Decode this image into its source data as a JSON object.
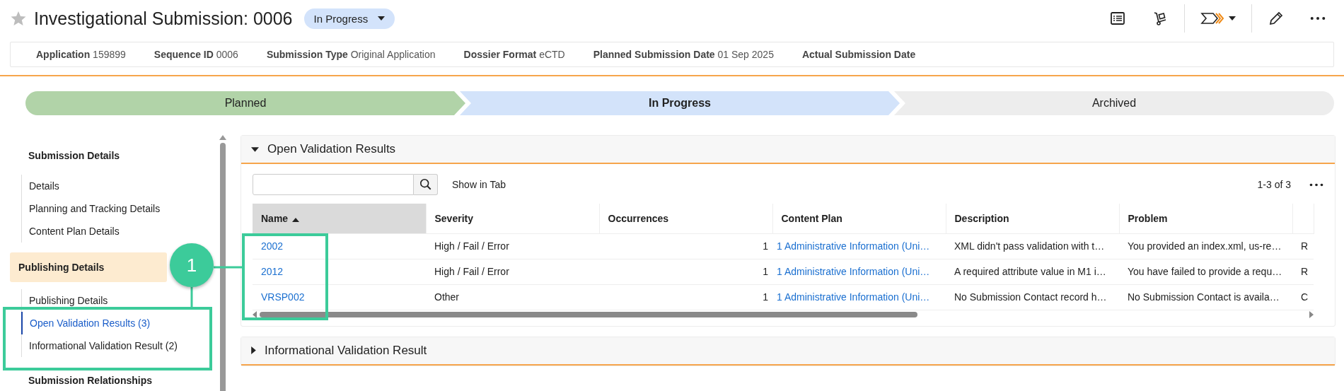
{
  "header": {
    "title": "Investigational Submission: 0006",
    "favorite": false,
    "status": "In Progress"
  },
  "meta": [
    {
      "label": "Application",
      "value": "159899"
    },
    {
      "label": "Sequence ID",
      "value": "0006"
    },
    {
      "label": "Submission Type",
      "value": "Original Application"
    },
    {
      "label": "Dossier Format",
      "value": "eCTD"
    },
    {
      "label": "Planned Submission Date",
      "value": "01 Sep 2025"
    },
    {
      "label": "Actual Submission Date"
    }
  ],
  "stages": [
    {
      "label": "Planned",
      "completed": true,
      "selected": false
    },
    {
      "label": "In Progress",
      "completed": false,
      "selected": true
    },
    {
      "label": "Archived",
      "completed": false,
      "selected": false
    }
  ],
  "sidebar": {
    "sections": [
      {
        "title": "Submission Details",
        "selected": false,
        "items": [
          {
            "label": "Details",
            "selected": false
          },
          {
            "label": "Planning and Tracking Details",
            "selected": false
          },
          {
            "label": "Content Plan Details",
            "selected": false
          }
        ]
      },
      {
        "title": "Publishing Details",
        "selected": true,
        "items": [
          {
            "label": "Publishing Details",
            "selected": false
          },
          {
            "label": "Open Validation Results (3)",
            "selected": true
          },
          {
            "label": "Informational Validation Result (2)",
            "selected": false
          }
        ]
      },
      {
        "title": "Submission Relationships",
        "selected": false
      }
    ]
  },
  "panels": [
    {
      "title": "Open Validation Results",
      "expanded": true,
      "show_in_tab": "Show in Tab",
      "count": "1-3 of 3",
      "table": {
        "columns": [
          {
            "label": "Name",
            "sorted": true
          },
          {
            "label": "Severity",
            "sorted": false
          },
          {
            "label": "Occurrences",
            "sorted": false
          },
          {
            "label": "Content Plan",
            "sorted": false
          },
          {
            "label": "Description",
            "sorted": false
          },
          {
            "label": "Problem",
            "sorted": false
          }
        ],
        "rows": [
          [
            "2002",
            "High / Fail / Error",
            "1",
            "1 Administrative Information (Uni…",
            "XML didn't pass validation with t…",
            "You provided an index.xml, us-re…",
            "R"
          ],
          [
            "2012",
            "High / Fail / Error",
            "1",
            "1 Administrative Information (Uni…",
            "A required attribute value in M1 i…",
            "You have failed to provide a requ…",
            "R"
          ],
          [
            "VRSP002",
            "Other",
            "1",
            "1 Administrative Information (Uni…",
            "No Submission Contact record h…",
            "No Submission Contact is availa…",
            "C"
          ]
        ]
      }
    },
    {
      "title": "Informational Validation Result",
      "expanded": false
    }
  ],
  "callout": {
    "label": "1"
  }
}
